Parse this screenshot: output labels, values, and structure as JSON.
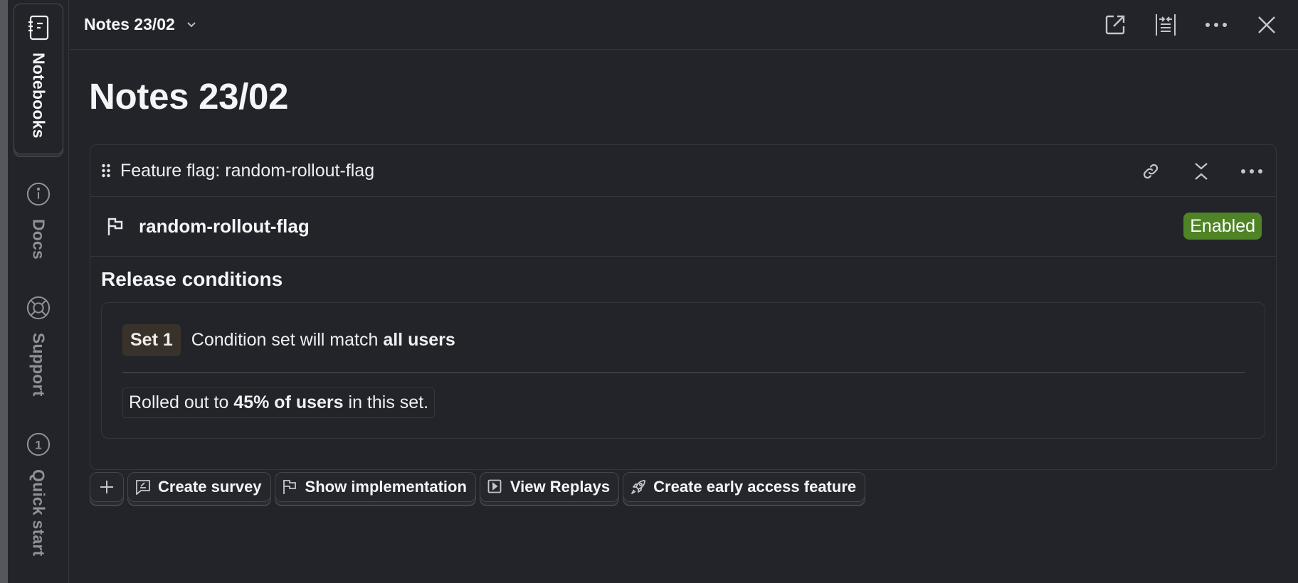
{
  "sidebar": {
    "items": [
      {
        "label": "Notebooks",
        "icon": "notebook-icon",
        "active": true
      },
      {
        "label": "Docs",
        "icon": "info-icon",
        "active": false
      },
      {
        "label": "Support",
        "icon": "lifebuoy-icon",
        "active": false
      },
      {
        "label": "Quick start",
        "icon": "quickstart-icon",
        "badge": "1",
        "active": false
      }
    ]
  },
  "header": {
    "title": "Notes 23/02",
    "actions": [
      "open-in-new-icon",
      "full-width-icon",
      "more-icon",
      "close-icon"
    ]
  },
  "page": {
    "title": "Notes 23/02"
  },
  "card": {
    "title": "Feature flag: random-rollout-flag",
    "actions": [
      "link-icon",
      "collapse-icon",
      "more-icon"
    ],
    "flag": {
      "name": "random-rollout-flag",
      "status": "Enabled",
      "status_color": "#4f8426"
    },
    "release_conditions": {
      "title": "Release conditions",
      "sets": [
        {
          "tag": "Set 1",
          "desc_prefix": "Condition set will match ",
          "desc_bold": "all users",
          "rollout_prefix": "Rolled out to ",
          "rollout_bold": "45% of users",
          "rollout_suffix": " in this set.",
          "rollout_percent": 45
        }
      ]
    }
  },
  "actions": [
    {
      "label": "",
      "icon": "plus-icon"
    },
    {
      "label": "Create survey",
      "icon": "survey-icon"
    },
    {
      "label": "Show implementation",
      "icon": "flag-icon"
    },
    {
      "label": "View Replays",
      "icon": "play-icon"
    },
    {
      "label": "Create early access feature",
      "icon": "rocket-icon"
    }
  ]
}
